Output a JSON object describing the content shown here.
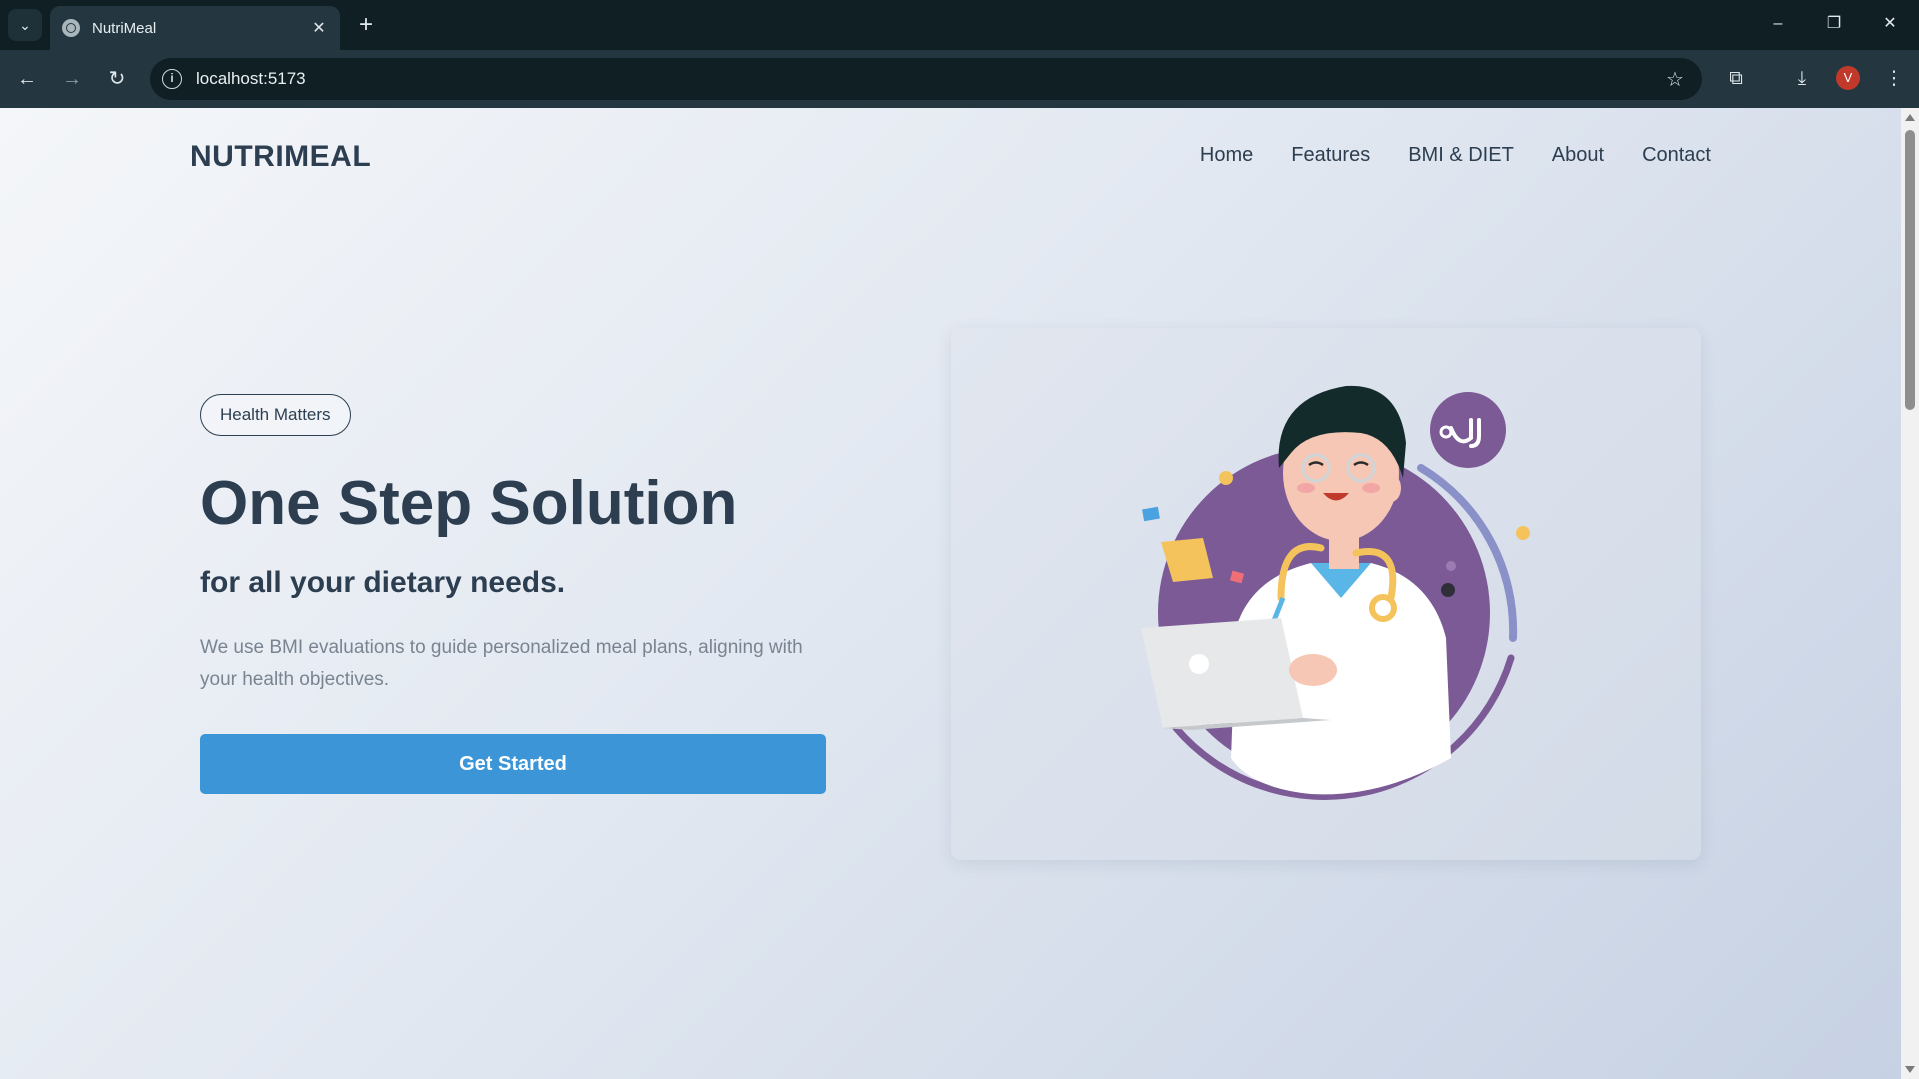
{
  "browser": {
    "tab_title": "NutriMeal",
    "url": "localhost:5173",
    "profile_initial": "V"
  },
  "site": {
    "brand": "NUTRIMEAL",
    "nav": [
      "Home",
      "Features",
      "BMI & DIET",
      "About",
      "Contact"
    ]
  },
  "hero": {
    "badge": "Health Matters",
    "title": "One Step Solution",
    "subtitle": "for all your dietary needs.",
    "description": "We use BMI evaluations to guide personalized meal plans, aligning with your health objectives.",
    "cta_label": "Get Started"
  },
  "colors": {
    "heading": "#2c3e50",
    "accent": "#3b95d6",
    "illustration_purple": "#7b5a96"
  },
  "icons": {
    "tab_search": "chevron-down-icon",
    "favicon": "globe-icon",
    "close": "close-icon",
    "new_tab": "plus-icon",
    "back": "arrow-left-icon",
    "forward": "arrow-right-icon",
    "reload": "reload-icon",
    "site_info": "info-icon",
    "bookmark": "star-icon",
    "extensions": "puzzle-icon",
    "download": "download-icon",
    "menu": "kebab-menu-icon"
  }
}
